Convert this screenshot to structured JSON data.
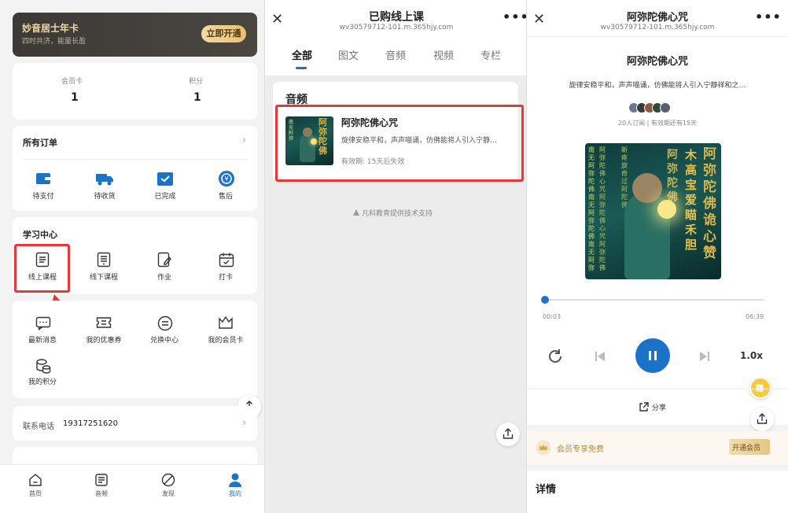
{
  "panel_member": {
    "vip_card": {
      "title": "妙音居士年卡",
      "subtitle": "四时共济，能量长盈",
      "button": "立即开通"
    },
    "stats": [
      {
        "label": "会员卡",
        "value": "1"
      },
      {
        "label": "积分",
        "value": "1"
      }
    ],
    "orders": {
      "title": "所有订单",
      "items": [
        "待支付",
        "待收货",
        "已完成",
        "售后"
      ]
    },
    "learning": {
      "title": "学习中心",
      "items": [
        "线上课程",
        "线下课程",
        "作业",
        "打卡"
      ]
    },
    "tools": [
      "最新消息",
      "我的优惠券",
      "兑换中心",
      "我的会员卡",
      "我的积分"
    ],
    "contact": {
      "label": "联系电话",
      "phone": "19317251620"
    },
    "tabbar": [
      "首页",
      "音频",
      "发现",
      "我的"
    ],
    "colors": {
      "active_tab": "#1a73c7",
      "highlight_box": "#e53935",
      "vip_gold": "#e8bf73"
    }
  },
  "panel_purchased": {
    "title": "已购线上课",
    "url": "wv30579712-101.m.365hjy.com",
    "tabs": [
      "全部",
      "图文",
      "音频",
      "视频",
      "专栏"
    ],
    "active_tab": "全部",
    "section": "音频",
    "course": {
      "title": "阿弥陀佛心咒",
      "desc": "旋律安稳平和，声声喵诵，仿佛能将人引入宁静…",
      "validity": "有效期:  15天后失效"
    },
    "footer": "凡科教育提供技术支持"
  },
  "panel_player": {
    "title": "阿弥陀佛心咒",
    "url": "wv30579712-101.m.365hjy.com",
    "track_title": "阿弥陀佛心咒",
    "desc": "旋律安稳平和，声声喵诵，仿佛能将人引入宁静祥和之…",
    "meta": "20人订阅  |  有效期还有15天",
    "cover_text": [
      "阿弥陀",
      "南无阿弥陀佛",
      "阿弥陀佛心咒"
    ],
    "time_current": "00:03",
    "time_total": "06:39",
    "progress": 0.01,
    "speed": "1.0x",
    "share": "分享",
    "member_free": "会员专享免费",
    "open_member": "开通会员",
    "details": "详情",
    "badge": "赚"
  }
}
